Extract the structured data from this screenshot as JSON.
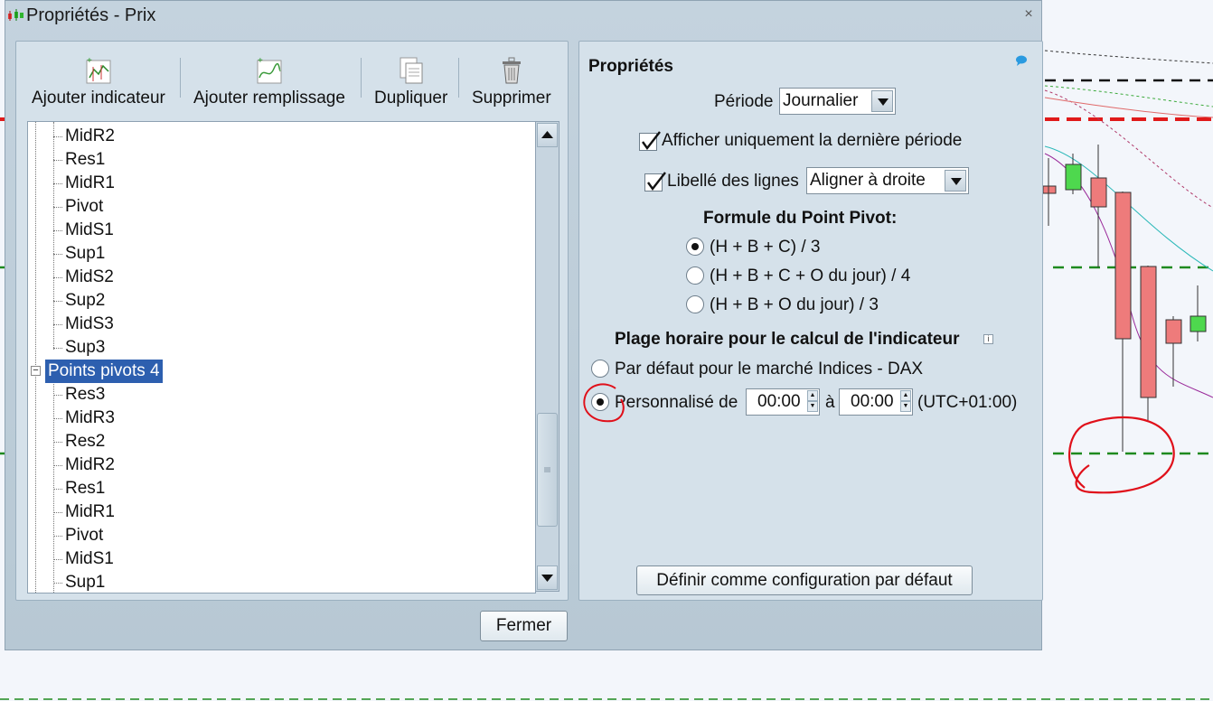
{
  "window": {
    "title": "Propriétés - Prix",
    "close_glyph": "×"
  },
  "toolbar": {
    "add_indicator": "Ajouter indicateur",
    "add_fill": "Ajouter remplissage",
    "duplicate": "Dupliquer",
    "delete": "Supprimer"
  },
  "tree": {
    "items": [
      {
        "label": "MidR2"
      },
      {
        "label": "Res1"
      },
      {
        "label": "MidR1"
      },
      {
        "label": "Pivot"
      },
      {
        "label": "MidS1"
      },
      {
        "label": "Sup1"
      },
      {
        "label": "MidS2"
      },
      {
        "label": "Sup2"
      },
      {
        "label": "MidS3"
      },
      {
        "label": "Sup3"
      },
      {
        "label": "Points pivots 4"
      },
      {
        "label": "Res3"
      },
      {
        "label": "MidR3"
      },
      {
        "label": "Res2"
      },
      {
        "label": "MidR2"
      },
      {
        "label": "Res1"
      },
      {
        "label": "MidR1"
      },
      {
        "label": "Pivot"
      },
      {
        "label": "MidS1"
      },
      {
        "label": "Sup1"
      }
    ],
    "selected": "Points pivots 4",
    "collapse_glyph": "−"
  },
  "properties": {
    "heading": "Propriétés",
    "period_label": "Période",
    "period_value": "Journalier",
    "show_last_period": {
      "label": "Afficher uniquement la dernière période",
      "checked": true
    },
    "line_labels": {
      "label": "Libellé des lignes",
      "checked": true,
      "value": "Aligner à droite"
    },
    "pivot_formula_heading": "Formule du Point Pivot:",
    "formulas": [
      {
        "label": "(H + B + C) / 3",
        "selected": true
      },
      {
        "label": "(H + B + C + O du jour) / 4",
        "selected": false
      },
      {
        "label": "(H + B + O du jour) / 3",
        "selected": false
      }
    ],
    "time_range_heading": "Plage horaire pour le calcul de l'indicateur",
    "info_glyph": "i",
    "default_market": {
      "label": "Par défaut pour le marché Indices - DAX",
      "selected": false
    },
    "custom": {
      "label": "Personnalisé de",
      "selected": true,
      "from": "00:00",
      "to_label": "à",
      "to": "00:00",
      "timezone": "(UTC+01:00)"
    },
    "set_default_button": "Définir comme configuration par défaut"
  },
  "footer": {
    "close_button": "Fermer"
  },
  "colors": {
    "selection": "#2d5faf",
    "annotation_red": "#e0101a",
    "candle_red": "#ee7b7b",
    "candle_green": "#4ed84e"
  }
}
